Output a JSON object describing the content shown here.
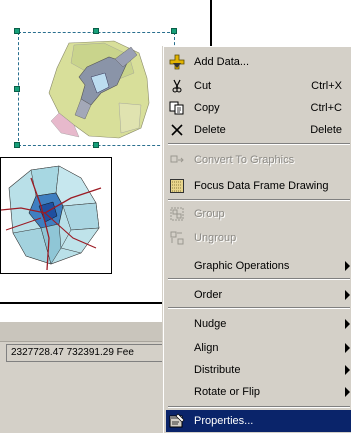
{
  "statusbar": {
    "coordinates": "2327728.47  732391.29 Fee"
  },
  "context_menu": {
    "items": [
      {
        "label": "Add Data...",
        "shortcut": "",
        "icon": "add-data-icon",
        "enabled": true
      },
      {
        "label": "Cut",
        "shortcut": "Ctrl+X",
        "icon": "scissors-icon",
        "enabled": true
      },
      {
        "label": "Copy",
        "shortcut": "Ctrl+C",
        "icon": "copy-icon",
        "enabled": true
      },
      {
        "label": "Delete",
        "shortcut": "Delete",
        "icon": "delete-x-icon",
        "enabled": true
      },
      {
        "label": "Convert To Graphics",
        "shortcut": "",
        "icon": "convert-graphics-icon",
        "enabled": false
      },
      {
        "label": "Focus Data Frame Drawing",
        "shortcut": "",
        "icon": "focus-frame-icon",
        "enabled": true
      },
      {
        "label": "Group",
        "shortcut": "",
        "icon": "group-icon",
        "enabled": false
      },
      {
        "label": "Ungroup",
        "shortcut": "",
        "icon": "ungroup-icon",
        "enabled": false
      },
      {
        "label": "Graphic Operations",
        "shortcut": "",
        "submenu": true,
        "enabled": true
      },
      {
        "label": "Order",
        "shortcut": "",
        "submenu": true,
        "enabled": true
      },
      {
        "label": "Nudge",
        "shortcut": "",
        "submenu": true,
        "enabled": true
      },
      {
        "label": "Align",
        "shortcut": "",
        "submenu": true,
        "enabled": true
      },
      {
        "label": "Distribute",
        "shortcut": "",
        "submenu": true,
        "enabled": true
      },
      {
        "label": "Rotate or Flip",
        "shortcut": "",
        "submenu": true,
        "enabled": true
      },
      {
        "label": "Properties...",
        "shortcut": "",
        "icon": "properties-icon",
        "enabled": true,
        "highlighted": true
      }
    ]
  },
  "colors": {
    "menu_bg": "#d4d0c8",
    "highlight": "#0a246a",
    "selection_handle": "#17a07a"
  }
}
